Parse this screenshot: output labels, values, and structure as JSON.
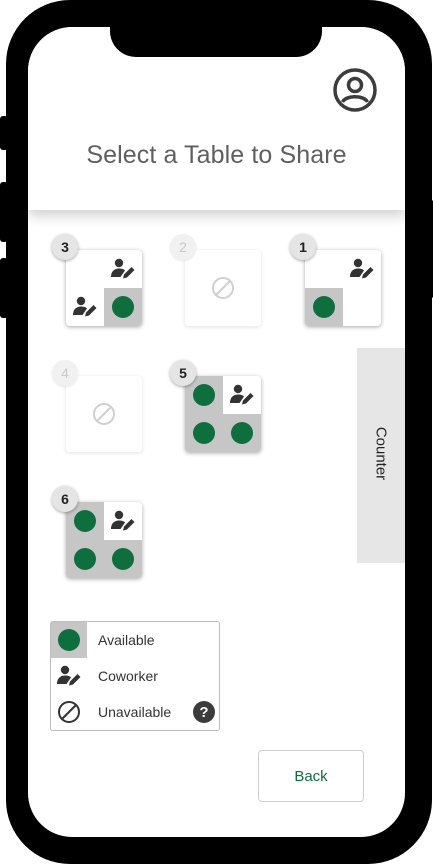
{
  "header": {
    "title": "Select a Table to Share",
    "profile_icon": "account-circle-icon"
  },
  "tables": [
    {
      "number": "3",
      "status": "available",
      "layout": [
        "coworker-empty",
        "coworker",
        "coworker",
        "available"
      ]
    },
    {
      "number": "2",
      "status": "unavailable"
    },
    {
      "number": "1",
      "status": "available",
      "layout": [
        "empty",
        "coworker",
        "available",
        "empty"
      ]
    },
    {
      "number": "4",
      "status": "unavailable"
    },
    {
      "number": "5",
      "status": "available",
      "layout": [
        "available",
        "coworker",
        "available",
        "available"
      ]
    },
    {
      "number": "6",
      "status": "available",
      "layout": [
        "available",
        "coworker",
        "available",
        "available"
      ]
    }
  ],
  "counter": {
    "label": "Counter"
  },
  "legend": {
    "available": "Available",
    "coworker": "Coworker",
    "unavailable": "Unavailable",
    "help_icon": "?"
  },
  "colors": {
    "seat_available": "#0e6e3e",
    "accent": "#0e6e3e"
  },
  "actions": {
    "back_label": "Back"
  }
}
